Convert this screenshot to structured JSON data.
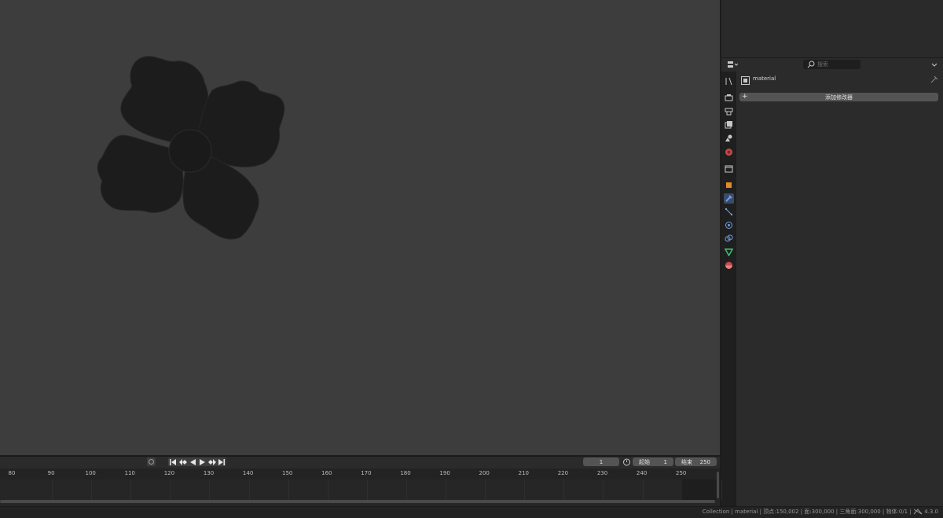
{
  "viewport": {
    "object_color": "#1c1c1c",
    "background": "#3d3d3d"
  },
  "properties": {
    "search_placeholder": "搜索",
    "object_name": "material",
    "add_modifier_label": "添加修改器",
    "add_modifier_plus": "+",
    "tabs": [
      "tool-tab",
      "render-tab",
      "output-tab",
      "view-layer-tab",
      "scene-tab",
      "world-tab",
      "collection-tab",
      "object-tab",
      "modifiers-tab",
      "particles-tab",
      "physics-tab",
      "constraints-tab",
      "data-tab",
      "material-tab"
    ],
    "active_tab": "modifiers-tab"
  },
  "timeline": {
    "current_frame": "1",
    "start_label": "起始",
    "start_value": "1",
    "end_label": "结束",
    "end_value": "250",
    "ticks": [
      "80",
      "90",
      "100",
      "110",
      "120",
      "130",
      "140",
      "150",
      "160",
      "170",
      "180",
      "190",
      "200",
      "210",
      "220",
      "230",
      "240",
      "250"
    ]
  },
  "status": {
    "text": "Collection | material | 顶点:150,002 | 面:300,000 | 三角面:300,000 | 物体:0/1 |",
    "version": "4.3.0"
  }
}
